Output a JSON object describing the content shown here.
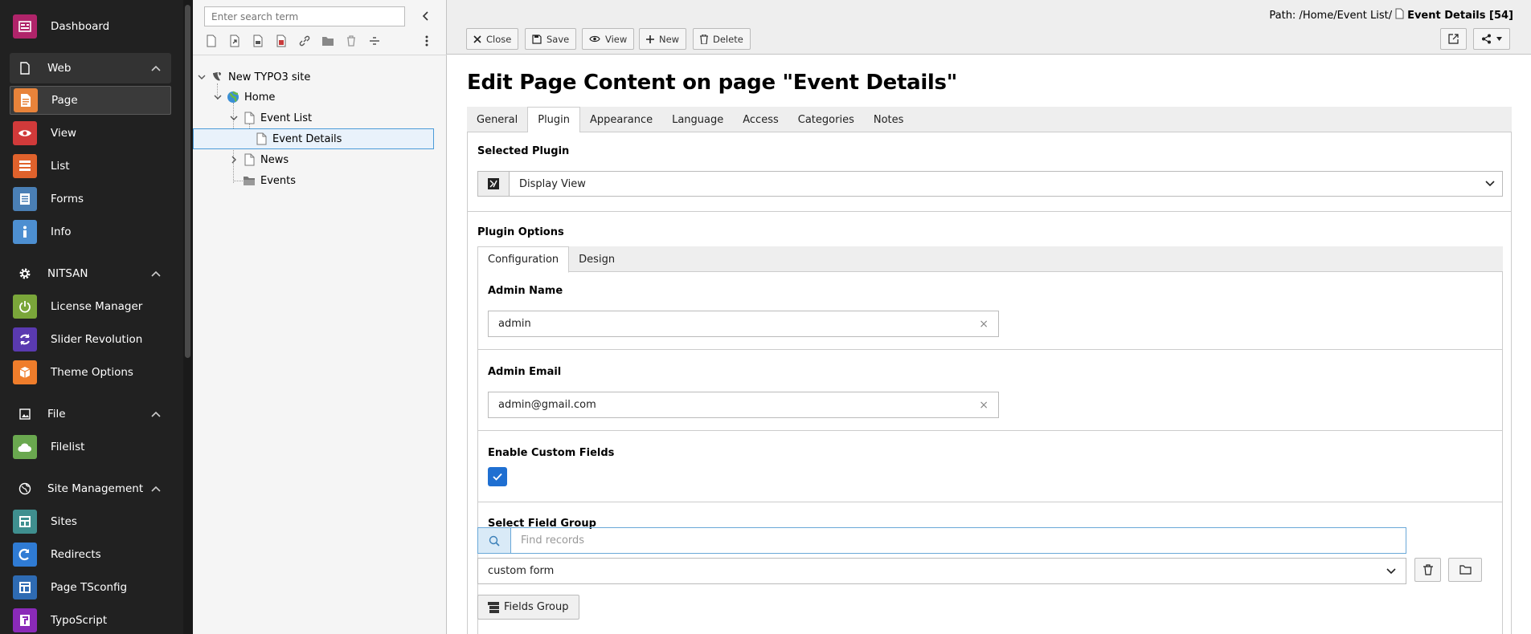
{
  "modmenu": {
    "items": [
      {
        "label": "Dashboard",
        "icon": "dashboard-icon",
        "color": "#b0246a"
      },
      {
        "label": "Page",
        "icon": "page-module-icon",
        "color": "#e8833a"
      },
      {
        "label": "View",
        "icon": "eye-icon",
        "color": "#d13a3a"
      },
      {
        "label": "List",
        "icon": "list-module-icon",
        "color": "#e0622c"
      },
      {
        "label": "Forms",
        "icon": "forms-icon",
        "color": "#4a7fb5"
      },
      {
        "label": "Info",
        "icon": "info-icon",
        "color": "#4d8fd1"
      },
      {
        "label": "License Manager",
        "icon": "power-icon",
        "color": "#7aa63a"
      },
      {
        "label": "Slider Revolution",
        "icon": "refresh-icon",
        "color": "#5a3ab0"
      },
      {
        "label": "Theme Options",
        "icon": "cube-icon",
        "color": "#ef7d2b"
      },
      {
        "label": "Filelist",
        "icon": "filelist-icon",
        "color": "#6aa84f"
      },
      {
        "label": "Sites",
        "icon": "sites-icon",
        "color": "#3f8f8f"
      },
      {
        "label": "Redirects",
        "icon": "redirect-icon",
        "color": "#2f7bd4"
      },
      {
        "label": "Page TSconfig",
        "icon": "tsconfig-icon",
        "color": "#2e6bb3"
      },
      {
        "label": "TypoScript",
        "icon": "typoscript-icon",
        "color": "#8a2ab8"
      }
    ],
    "groups": [
      {
        "label": "Web",
        "icon": "page-outline-icon"
      },
      {
        "label": "NITSAN",
        "icon": "gear-icon"
      },
      {
        "label": "File",
        "icon": "image-icon"
      },
      {
        "label": "Site Management",
        "icon": "globe-icon"
      }
    ]
  },
  "tree": {
    "search_placeholder": "Enter search term",
    "nodes": [
      {
        "label": "New TYPO3 site"
      },
      {
        "label": "Home"
      },
      {
        "label": "Event List"
      },
      {
        "label": "Event Details"
      },
      {
        "label": "News"
      },
      {
        "label": "Events"
      }
    ]
  },
  "header": {
    "path_prefix": "Path: /Home/Event List/",
    "path_page": "Event Details [54]",
    "buttons": {
      "close": "Close",
      "save": "Save",
      "view": "View",
      "new": "New",
      "delete": "Delete"
    }
  },
  "main": {
    "title": "Edit Page Content on page \"Event Details\"",
    "tabs": [
      "General",
      "Plugin",
      "Appearance",
      "Language",
      "Access",
      "Categories",
      "Notes"
    ],
    "active_tab": "Plugin",
    "selected_plugin_label": "Selected Plugin",
    "selected_plugin_value": "Display View",
    "plugin_options_label": "Plugin Options",
    "subtabs": [
      "Configuration",
      "Design"
    ],
    "admin_name_label": "Admin Name",
    "admin_name_value": "admin",
    "admin_email_label": "Admin Email",
    "admin_email_value": "admin@gmail.com",
    "custom_fields_label": "Enable Custom Fields",
    "custom_fields_checked": true,
    "field_group_label": "Select Field Group",
    "find_records_placeholder": "Find records",
    "field_group_value": "custom form",
    "fields_group_button": "Fields Group"
  }
}
